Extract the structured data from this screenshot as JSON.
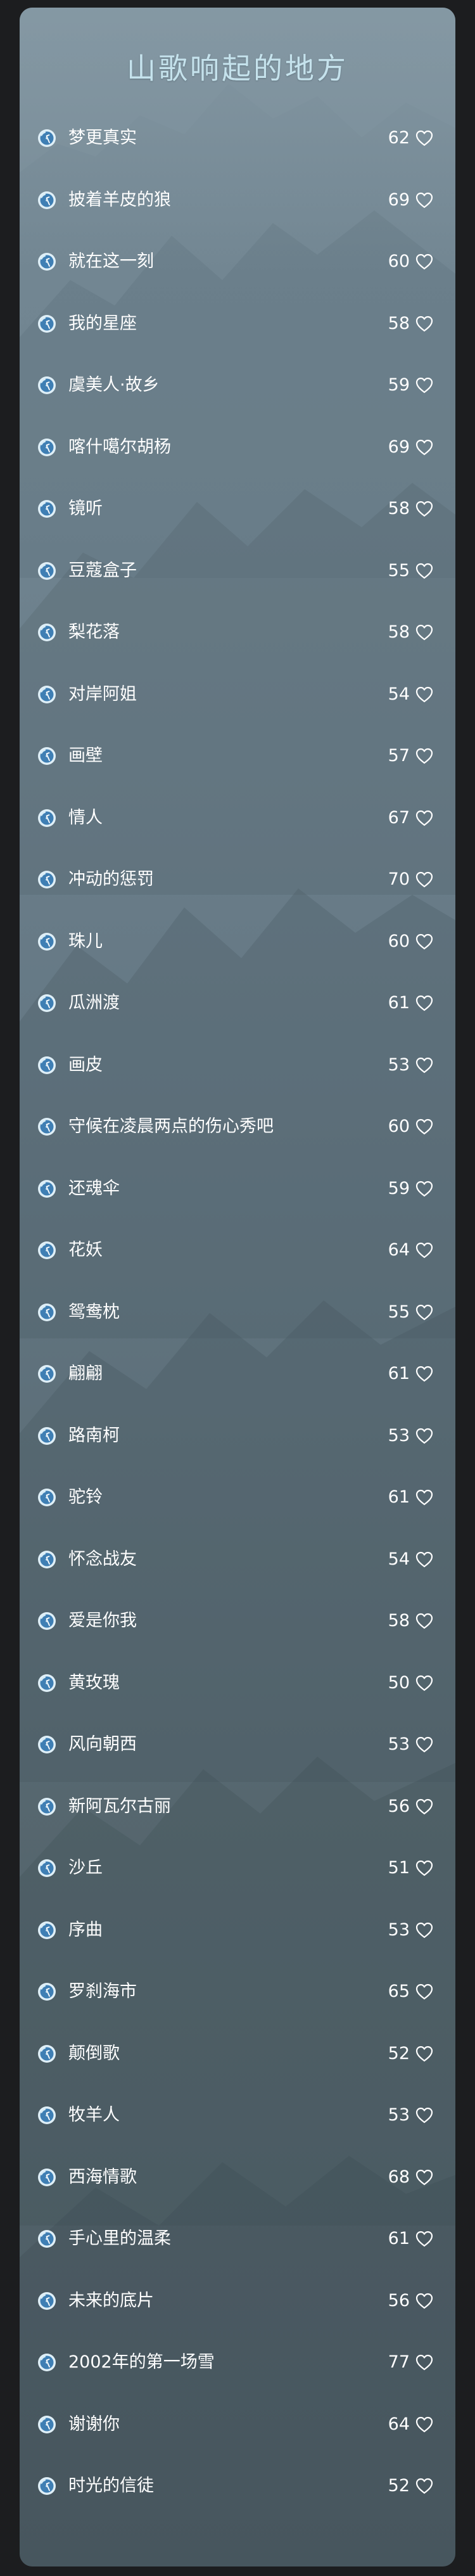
{
  "title": "山歌响起的地方",
  "icons": {
    "row_icon": "music-disc-icon",
    "like_icon": "heart-outline-icon"
  },
  "colors": {
    "page_background": "#1c1d1f",
    "panel_top": "#758995",
    "panel_bottom": "#4c5b63",
    "title": "#c5e2ec",
    "text": "#ffffff",
    "disc_outer": "#dfeff7",
    "disc_inner": "#3f7fb4"
  },
  "songs": [
    {
      "title": "梦更真实",
      "count": "62"
    },
    {
      "title": "披着羊皮的狼",
      "count": "69"
    },
    {
      "title": "就在这一刻",
      "count": "60"
    },
    {
      "title": "我的星座",
      "count": "58"
    },
    {
      "title": "虞美人·故乡",
      "count": "59"
    },
    {
      "title": "喀什噶尔胡杨",
      "count": "69"
    },
    {
      "title": "镜听",
      "count": "58"
    },
    {
      "title": "豆蔻盒子",
      "count": "55"
    },
    {
      "title": "梨花落",
      "count": "58"
    },
    {
      "title": "对岸阿姐",
      "count": "54"
    },
    {
      "title": "画壁",
      "count": "57"
    },
    {
      "title": "情人",
      "count": "67"
    },
    {
      "title": "冲动的惩罚",
      "count": "70"
    },
    {
      "title": "珠儿",
      "count": "60"
    },
    {
      "title": "瓜洲渡",
      "count": "61"
    },
    {
      "title": "画皮",
      "count": "53"
    },
    {
      "title": "守候在凌晨两点的伤心秀吧",
      "count": "60"
    },
    {
      "title": "还魂伞",
      "count": "59"
    },
    {
      "title": "花妖",
      "count": "64"
    },
    {
      "title": "鸳鸯枕",
      "count": "55"
    },
    {
      "title": "翩翩",
      "count": "61"
    },
    {
      "title": "路南柯",
      "count": "53"
    },
    {
      "title": "驼铃",
      "count": "61"
    },
    {
      "title": "怀念战友",
      "count": "54"
    },
    {
      "title": "爱是你我",
      "count": "58"
    },
    {
      "title": "黄玫瑰",
      "count": "50"
    },
    {
      "title": "风向朝西",
      "count": "53"
    },
    {
      "title": "新阿瓦尔古丽",
      "count": "56"
    },
    {
      "title": "沙丘",
      "count": "51"
    },
    {
      "title": "序曲",
      "count": "53"
    },
    {
      "title": "罗刹海市",
      "count": "65"
    },
    {
      "title": "颠倒歌",
      "count": "52"
    },
    {
      "title": "牧羊人",
      "count": "53"
    },
    {
      "title": "西海情歌",
      "count": "68"
    },
    {
      "title": "手心里的温柔",
      "count": "61"
    },
    {
      "title": "未来的底片",
      "count": "56"
    },
    {
      "title": "2002年的第一场雪",
      "count": "77"
    },
    {
      "title": "谢谢你",
      "count": "64"
    },
    {
      "title": "时光的信徒",
      "count": "52"
    }
  ]
}
